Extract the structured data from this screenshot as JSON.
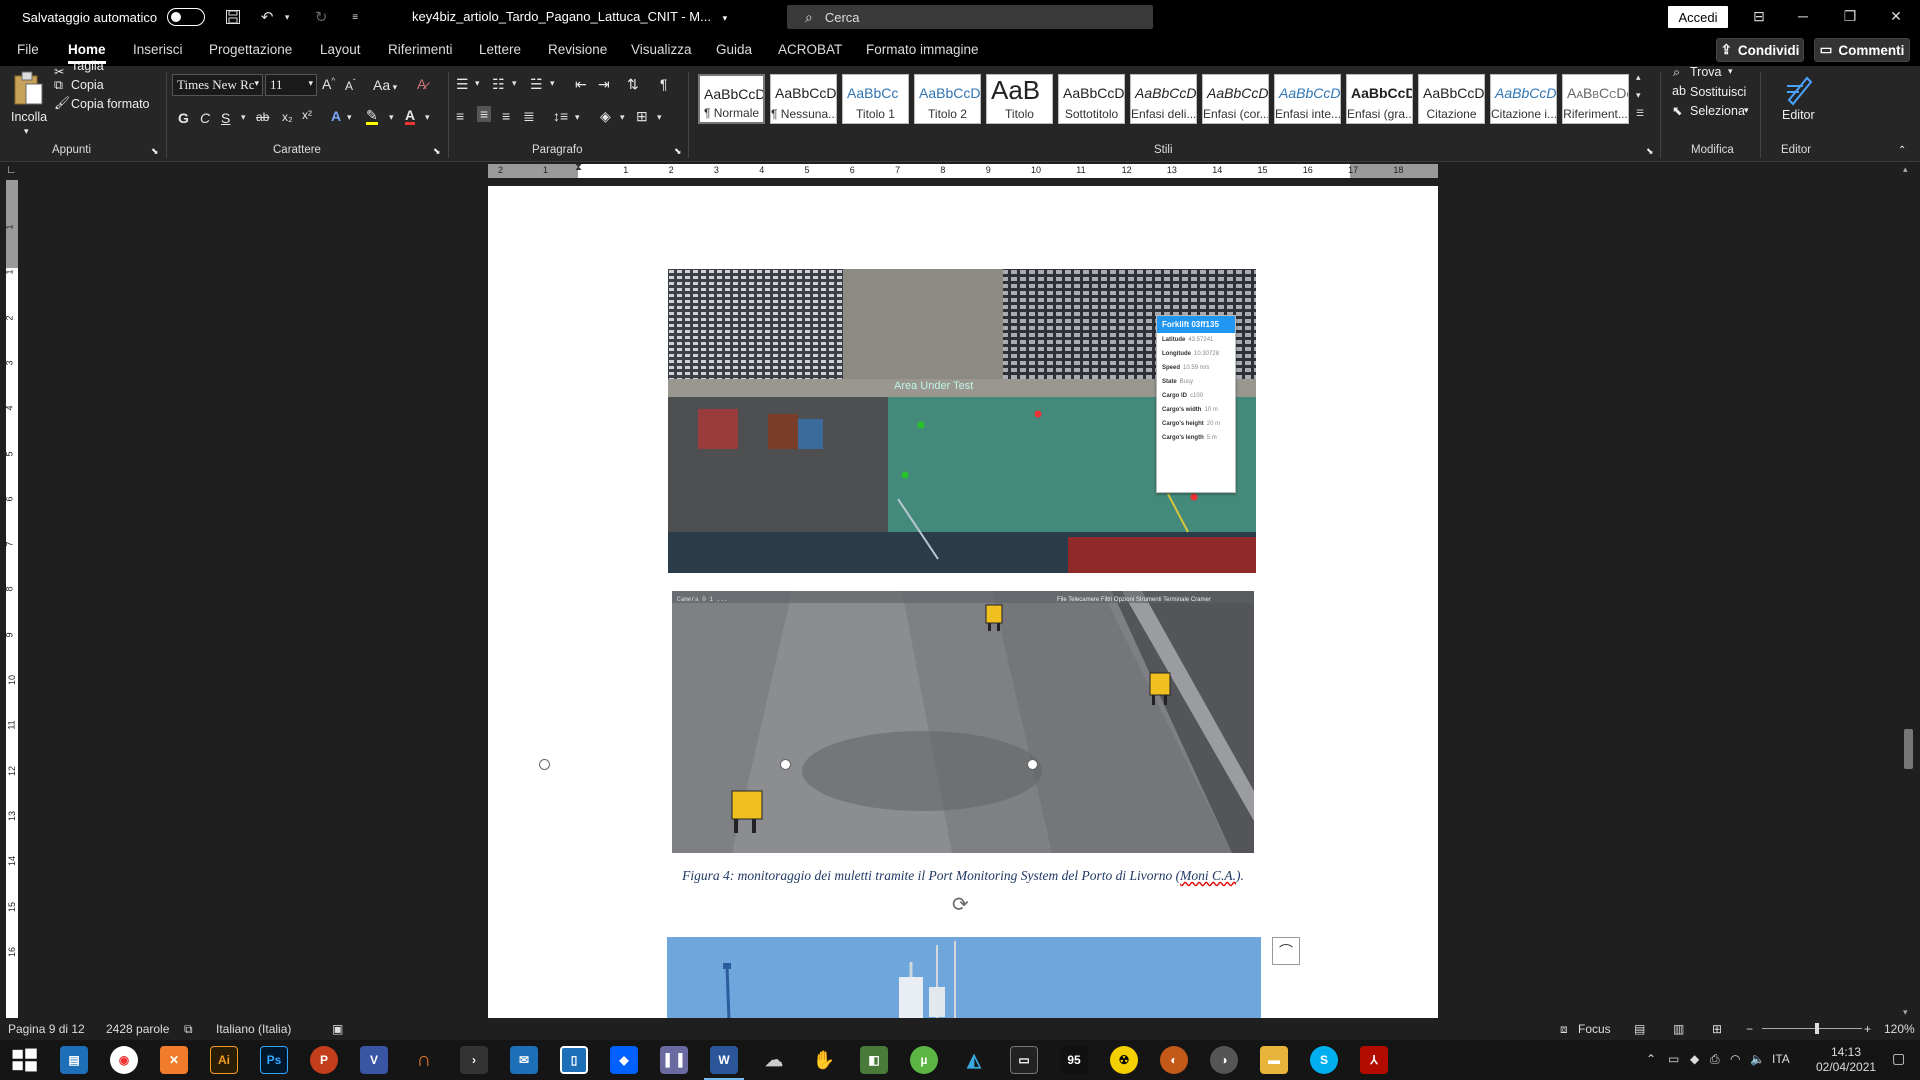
{
  "titlebar": {
    "autosave_label": "Salvataggio automatico",
    "doc_title": "key4biz_artiolo_Tardo_Pagano_Lattuca_CNIT - M...",
    "search_placeholder": "Cerca",
    "signin_label": "Accedi"
  },
  "menu": {
    "tabs": [
      "File",
      "Home",
      "Inserisci",
      "Progettazione",
      "Layout",
      "Riferimenti",
      "Lettere",
      "Revisione",
      "Visualizza",
      "Guida",
      "ACROBAT",
      "Formato immagine"
    ],
    "active": "Home",
    "share_label": "Condividi",
    "comments_label": "Commenti"
  },
  "ribbon": {
    "clipboard": {
      "paste_label": "Incolla",
      "cut_label": "Taglia",
      "copy_label": "Copia",
      "format_painter_label": "Copia formato",
      "group_label": "Appunti"
    },
    "font": {
      "font_name": "Times New Rc",
      "font_size": "11",
      "change_case": "Aa",
      "bold": "G",
      "italic": "C",
      "underline": "S",
      "strike": "ab",
      "group_label": "Carattere"
    },
    "paragraph": {
      "group_label": "Paragrafo"
    },
    "styles": {
      "group_label": "Stili",
      "items": [
        {
          "preview": "AaBbCcDc",
          "name": "¶ Normale"
        },
        {
          "preview": "AaBbCcDc",
          "name": "¶ Nessuna..."
        },
        {
          "preview": "AaBbCc",
          "name": "Titolo 1"
        },
        {
          "preview": "AaBbCcD",
          "name": "Titolo 2"
        },
        {
          "preview": "AaB",
          "name": "Titolo"
        },
        {
          "preview": "AaBbCcD",
          "name": "Sottotitolo"
        },
        {
          "preview": "AaBbCcDc",
          "name": "Enfasi deli..."
        },
        {
          "preview": "AaBbCcDc",
          "name": "Enfasi (cor..."
        },
        {
          "preview": "AaBbCcDc",
          "name": "Enfasi inte..."
        },
        {
          "preview": "AaBbCcDc",
          "name": "Enfasi (gra..."
        },
        {
          "preview": "AaBbCcDc",
          "name": "Citazione"
        },
        {
          "preview": "AaBbCcDc",
          "name": "Citazione i..."
        },
        {
          "preview": "AaBbCcDc",
          "name": "Riferiment..."
        }
      ]
    },
    "editing": {
      "find_label": "Trova",
      "replace_label": "Sostituisci",
      "select_label": "Seleziona",
      "group_label": "Modifica"
    },
    "editor": {
      "label": "Editor",
      "group_label": "Editor"
    }
  },
  "ruler": {
    "top_numbers": [
      "2",
      "1",
      "1",
      "2",
      "3",
      "4",
      "5",
      "6",
      "7",
      "8",
      "9",
      "10",
      "11",
      "12",
      "13",
      "14",
      "15",
      "16",
      "17",
      "18"
    ],
    "left_numbers": [
      "1",
      "1",
      "2",
      "3",
      "4",
      "5",
      "6",
      "7",
      "8",
      "9",
      "10",
      "11",
      "12",
      "13",
      "14",
      "15",
      "16"
    ]
  },
  "document": {
    "aerial": {
      "area_label": "Area Under Test",
      "popup_title": "Forklift 03ff135",
      "popup_rows": [
        {
          "k": "Latitude",
          "v": "43.57241"
        },
        {
          "k": "Longitude",
          "v": "10.30728"
        },
        {
          "k": "Speed",
          "v": "10.59 m/s"
        },
        {
          "k": "State",
          "v": "Busy"
        },
        {
          "k": "Cargo ID",
          "v": "c100"
        },
        {
          "k": "Cargo's width",
          "v": "10 m"
        },
        {
          "k": "Cargo's height",
          "v": "20 m"
        },
        {
          "k": "Cargo's length",
          "v": "5 m"
        }
      ]
    },
    "sim_menu": "File Telecamere Filtri Opzioni Strumenti Terminale Cramer",
    "caption_main": "Figura 4: monitoraggio dei muletti tramite il Port Monitoring System del Porto di Livorno (",
    "caption_ref": "Moni C.A.",
    "caption_end": ")."
  },
  "statusbar": {
    "page": "Pagina 9 di 12",
    "words": "2428 parole",
    "language": "Italiano (Italia)",
    "focus": "Focus",
    "zoom": "120%",
    "zoom_level": 0.55
  },
  "taskbar": {
    "lang": "ITA",
    "time": "14:13",
    "date": "02/04/2021"
  }
}
